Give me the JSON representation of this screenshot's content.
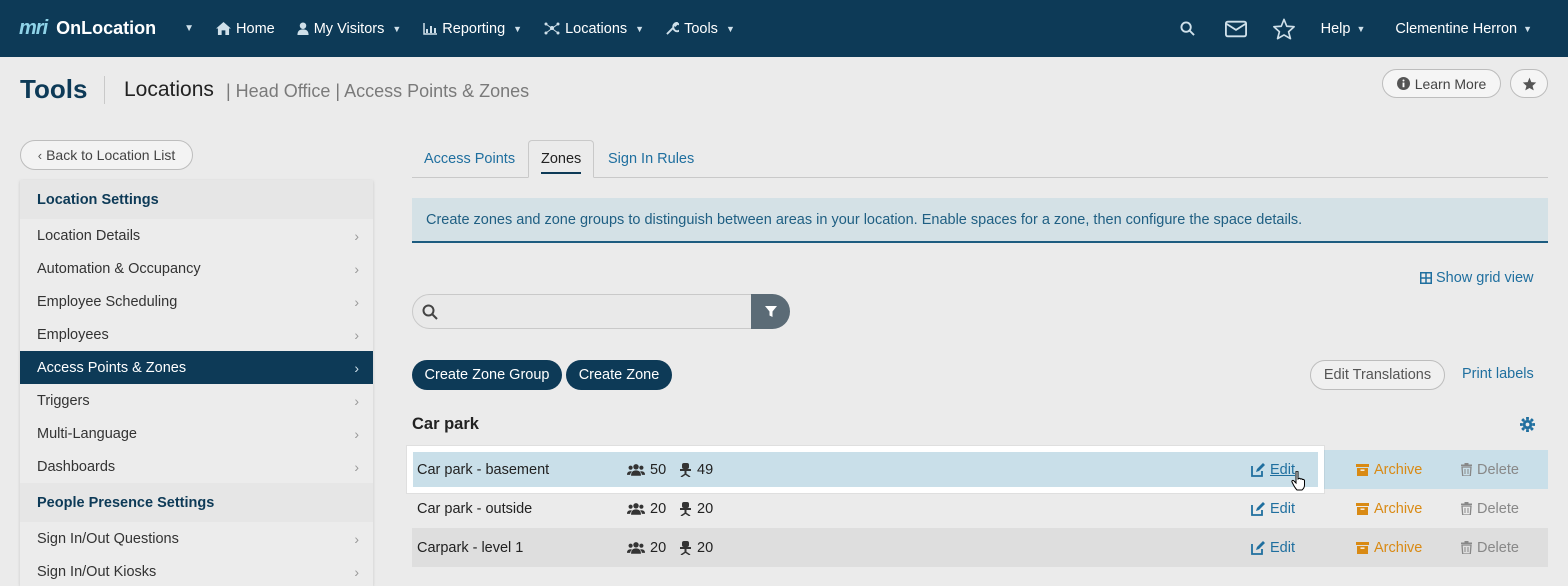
{
  "nav": {
    "logo": "mri",
    "app_name": "OnLocation",
    "items": [
      {
        "label": "Home",
        "icon": "home-icon"
      },
      {
        "label": "My Visitors",
        "icon": "user-icon"
      },
      {
        "label": "Reporting",
        "icon": "chart-icon"
      },
      {
        "label": "Locations",
        "icon": "network-icon"
      },
      {
        "label": "Tools",
        "icon": "wrench-icon"
      }
    ],
    "help": "Help",
    "user": "Clementine Herron"
  },
  "header": {
    "title": "Tools",
    "crumb_main": "Locations",
    "crumb_sub": "| Head Office | Access Points & Zones",
    "learn_more": "Learn More"
  },
  "sidebar": {
    "back": "Back to Location List",
    "section1": "Location Settings",
    "items1": [
      "Location Details",
      "Automation & Occupancy",
      "Employee Scheduling",
      "Employees",
      "Access Points & Zones",
      "Triggers",
      "Multi-Language",
      "Dashboards"
    ],
    "section2": "People Presence Settings",
    "items2": [
      "Sign In/Out Questions",
      "Sign In/Out Kiosks"
    ]
  },
  "tabs": [
    "Access Points",
    "Zones",
    "Sign In Rules"
  ],
  "info": "Create zones and zone groups to distinguish between areas in your location. Enable spaces for a zone, then configure the space details.",
  "grid_link": "Show grid view",
  "search": {
    "placeholder": ""
  },
  "actions": {
    "create_group": "Create Zone Group",
    "create_zone": "Create Zone",
    "edit_translations": "Edit Translations",
    "print_labels": "Print labels"
  },
  "group": {
    "title": "Car park",
    "rows": [
      {
        "name": "Car park - basement",
        "capacity": "50",
        "spaces": "49"
      },
      {
        "name": "Car park - outside",
        "capacity": "20",
        "spaces": "20"
      },
      {
        "name": "Carpark - level 1",
        "capacity": "20",
        "spaces": "20"
      }
    ],
    "edit": "Edit",
    "archive": "Archive",
    "delete": "Delete"
  },
  "colors": {
    "brand": "#0d3a57",
    "link": "#1f6f9f",
    "archive": "#d98a14"
  }
}
